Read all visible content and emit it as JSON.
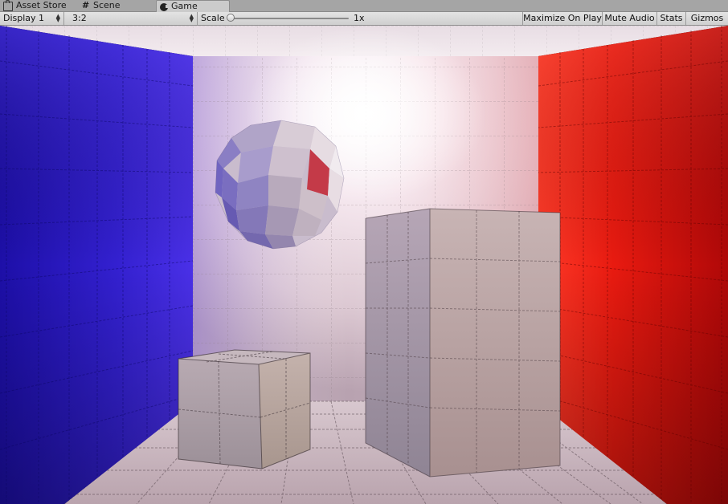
{
  "tabs": [
    {
      "label": "Asset Store",
      "icon": "asset-store-icon",
      "active": false
    },
    {
      "label": "Scene",
      "icon": "scene-grid-icon",
      "active": false
    },
    {
      "label": "Game",
      "icon": "game-controller-icon",
      "active": true
    }
  ],
  "toolbar": {
    "display": "Display 1",
    "aspect": "3:2",
    "scale_label": "Scale",
    "scale_value": "1x",
    "scale_level": 0.0,
    "maximize_on_play": "Maximize On Play",
    "mute_audio": "Mute Audio",
    "stats": "Stats",
    "gizmos": "Gizmos"
  },
  "scene_colors": {
    "left_wall": "#3a1fd6",
    "right_wall": "#f01a0f",
    "back_wall": "#efe3e8",
    "floor": "#d9c9cf",
    "light": "#ffffff"
  },
  "scene_objects": [
    "blue-left-wall",
    "red-right-wall",
    "white-back-wall",
    "tiled-floor",
    "low-poly-sphere",
    "small-cube",
    "tall-box"
  ]
}
